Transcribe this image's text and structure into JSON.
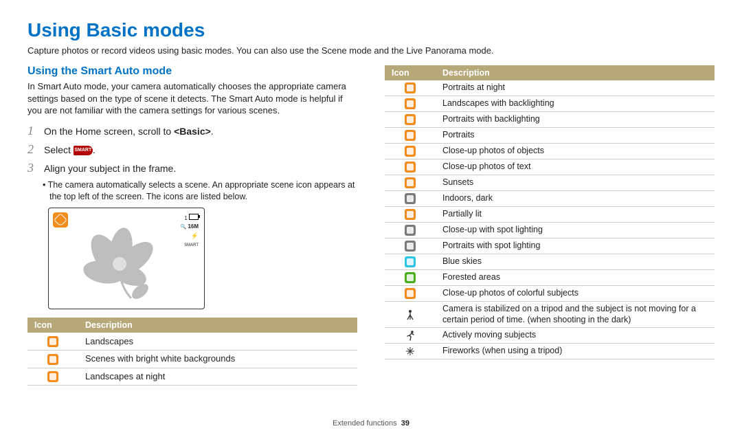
{
  "title": "Using Basic modes",
  "subtitle": "Capture photos or record videos using basic modes. You can also use the Scene mode and the Live Panorama mode.",
  "section_heading": "Using the Smart Auto mode",
  "intro": "In Smart Auto mode, your camera automatically chooses the appropriate camera settings based on the type of scene it detects. The Smart Auto mode is helpful if you are not familiar with the camera settings for various scenes.",
  "steps": [
    {
      "num": "1",
      "text_before": "On the Home screen, scroll to ",
      "bold": "<Basic>",
      "text_after": "."
    },
    {
      "num": "2",
      "text_before": "Select ",
      "icon": "smart",
      "text_after": "."
    },
    {
      "num": "3",
      "text_before": "Align your subject in the frame.",
      "bold": "",
      "text_after": ""
    }
  ],
  "sub_bullet": "The camera automatically selects a scene. An appropriate scene icon appears at the top left of the screen. The icons are listed below.",
  "smart_label": "SMART",
  "screen_overlay": {
    "counter": "1",
    "zoom_label": "16M",
    "flash_label": "SMART"
  },
  "table_headers": {
    "icon": "Icon",
    "description": "Description"
  },
  "left_rows": [
    {
      "color": "#f28c1c",
      "name": "landscape-icon",
      "desc": "Landscapes"
    },
    {
      "color": "#f28c1c",
      "name": "white-bg-icon",
      "desc": "Scenes with bright white backgrounds"
    },
    {
      "color": "#f28c1c",
      "name": "night-landscape-icon",
      "desc": "Landscapes at night"
    }
  ],
  "right_rows": [
    {
      "color": "#f28c1c",
      "name": "night-portrait-icon",
      "desc": "Portraits at night"
    },
    {
      "color": "#f28c1c",
      "name": "backlight-landscape-icon",
      "desc": "Landscapes with backlighting"
    },
    {
      "color": "#f28c1c",
      "name": "backlight-portrait-icon",
      "desc": "Portraits with backlighting"
    },
    {
      "color": "#f28c1c",
      "name": "portrait-icon",
      "desc": "Portraits"
    },
    {
      "color": "#f28c1c",
      "name": "macro-object-icon",
      "desc": "Close-up photos of objects"
    },
    {
      "color": "#f28c1c",
      "name": "macro-text-icon",
      "desc": "Close-up photos of text"
    },
    {
      "color": "#f28c1c",
      "name": "sunset-icon",
      "desc": "Sunsets"
    },
    {
      "color": "#7a7a7a",
      "name": "indoor-dark-icon",
      "desc": "Indoors, dark"
    },
    {
      "color": "#f28c1c",
      "name": "partial-light-icon",
      "desc": "Partially lit"
    },
    {
      "color": "#7a7a7a",
      "name": "macro-spot-icon",
      "desc": "Close-up with spot lighting"
    },
    {
      "color": "#7a7a7a",
      "name": "portrait-spot-icon",
      "desc": "Portraits with spot lighting"
    },
    {
      "color": "#2ec4e6",
      "name": "blue-sky-icon",
      "desc": "Blue skies"
    },
    {
      "color": "#4caf1f",
      "name": "forest-icon",
      "desc": "Forested areas"
    },
    {
      "color": "#f28c1c",
      "name": "macro-color-icon",
      "desc": "Close-up photos of colorful subjects"
    },
    {
      "glyph": "tripod",
      "name": "tripod-icon",
      "desc": "Camera is stabilized on a tripod and the subject is not moving for a certain period of time. (when shooting in the dark)"
    },
    {
      "glyph": "running",
      "name": "action-icon",
      "desc": "Actively moving subjects"
    },
    {
      "glyph": "fireworks",
      "name": "fireworks-icon",
      "desc": "Fireworks (when using a tripod)"
    }
  ],
  "footer": {
    "section": "Extended functions",
    "page": "39"
  }
}
